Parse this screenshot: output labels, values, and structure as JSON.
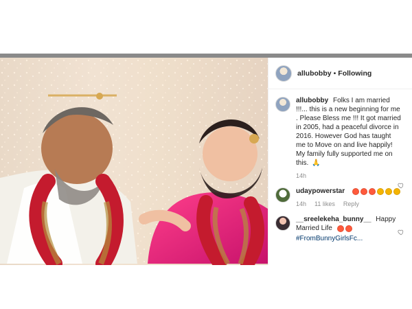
{
  "post": {
    "owner_handle": "allubobby",
    "follow_status": "Following",
    "caption_user": "allubobby",
    "caption_text": "Folks I am married !!!... this is a new beginning for me . Please Bless me !!! It got married in 2005, had a peaceful divorce in 2016. However God has taught me to Move on and live happily! My family fully supported me on this.",
    "caption_time": "14h"
  },
  "comments": [
    {
      "user": "udaypowerstar",
      "time": "14h",
      "likes": "11 likes",
      "reply": "Reply"
    },
    {
      "user": "__sreelekeha_bunny__",
      "text": "Happy Married Life",
      "hashtag": "#FromBunnyGirlsFc...",
      "time": ""
    }
  ],
  "ui": {
    "dot": "•"
  }
}
